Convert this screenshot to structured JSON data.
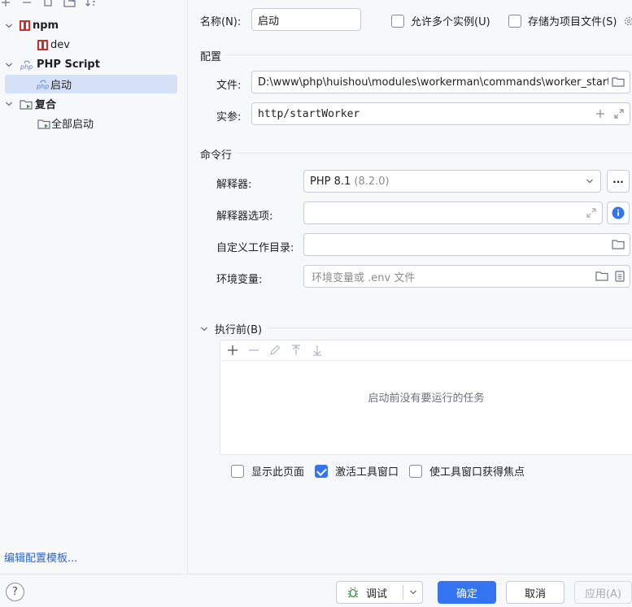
{
  "colors": {
    "accent": "#3574f0",
    "npm_red": "#c9302c",
    "php_blue": "#5e7fd1",
    "link": "#2f65ca",
    "selection": "#d5e1f7",
    "run_green": "#3c9a4a"
  },
  "toolbar_icons": [
    "add-icon",
    "remove-icon",
    "copy-icon",
    "new-folder-icon",
    "sort-icon"
  ],
  "tree": {
    "npm": {
      "label": "npm",
      "icon": "npm-icon"
    },
    "dev": {
      "label": "dev",
      "icon": "npm-icon"
    },
    "php": {
      "label": "PHP Script",
      "icon": "php-icon"
    },
    "start": {
      "label": "启动",
      "icon": "php-icon"
    },
    "compound": {
      "label": "复合",
      "icon": "compound-icon"
    },
    "all_start": {
      "label": "全部启动",
      "icon": "compound-icon"
    }
  },
  "edit_templates_link": "编辑配置模板...",
  "name": {
    "label": "名称(N):",
    "value": "启动"
  },
  "allow_multiple": {
    "label": "允许多个实例(U)",
    "checked": false
  },
  "store_as_file": {
    "label": "存储为项目文件(S)",
    "checked": false
  },
  "config": {
    "title": "配置",
    "file_label": "文件:",
    "file_value": "D:\\www\\php\\huishou\\modules\\workerman\\commands\\worker_start_for_win.php",
    "args_label": "实参:",
    "args_value": "http/startWorker"
  },
  "cmdline": {
    "title": "命令行",
    "interpreter_label": "解释器:",
    "interpreter_name": "PHP 8.1",
    "interpreter_version": "(8.2.0)",
    "more_label": "...",
    "options_label": "解释器选项:",
    "options_value": "",
    "workdir_label": "自定义工作目录:",
    "workdir_value": "",
    "env_label": "环境变量:",
    "env_placeholder": "环境变量或 .env 文件"
  },
  "before": {
    "title": "执行前(B)",
    "toolbar_icons": [
      "add-icon",
      "remove-icon",
      "edit-icon",
      "move-up-icon",
      "move-down-icon"
    ],
    "empty_text": "启动前没有要运行的任务"
  },
  "options": {
    "show_page": {
      "label": "显示此页面",
      "checked": false
    },
    "activate_tool": {
      "label": "激活工具窗口",
      "checked": true
    },
    "focus_tool": {
      "label": "使工具窗口获得焦点",
      "checked": false
    }
  },
  "buttons": {
    "help": "?",
    "debug": "调试",
    "ok": "确定",
    "cancel": "取消",
    "apply": "应用(A)"
  }
}
